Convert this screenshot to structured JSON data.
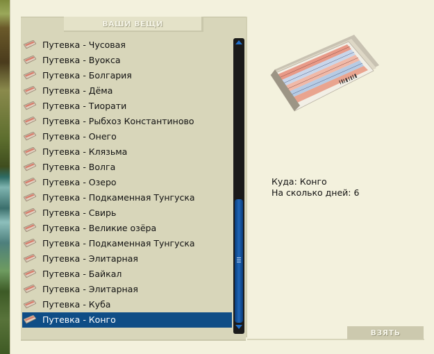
{
  "inventory": {
    "header": "ВАШИ ВЕЩИ",
    "items": [
      {
        "label": "Путевка - Чусовая",
        "icon": "ticket-icon"
      },
      {
        "label": "Путевка - Вуокса",
        "icon": "ticket-icon"
      },
      {
        "label": "Путевка - Болгария",
        "icon": "ticket-icon"
      },
      {
        "label": "Путевка - Дёма",
        "icon": "ticket-icon"
      },
      {
        "label": "Путевка - Тиорати",
        "icon": "ticket-icon"
      },
      {
        "label": "Путевка - Рыбхоз Константиново",
        "icon": "ticket-icon"
      },
      {
        "label": "Путевка - Онего",
        "icon": "ticket-icon"
      },
      {
        "label": "Путевка - Клязьма",
        "icon": "ticket-icon"
      },
      {
        "label": "Путевка - Волга",
        "icon": "ticket-icon"
      },
      {
        "label": "Путевка - Озеро",
        "icon": "ticket-icon"
      },
      {
        "label": "Путевка - Подкаменная Тунгуска",
        "icon": "ticket-icon"
      },
      {
        "label": "Путевка - Свирь",
        "icon": "ticket-icon"
      },
      {
        "label": "Путевка - Великие озёра",
        "icon": "ticket-icon"
      },
      {
        "label": "Путевка - Подкаменная Тунгуска",
        "icon": "ticket-icon"
      },
      {
        "label": "Путевка - Элитарная",
        "icon": "ticket-icon"
      },
      {
        "label": "Путевка - Байкал",
        "icon": "ticket-icon"
      },
      {
        "label": "Путевка - Элитарная",
        "icon": "ticket-icon"
      },
      {
        "label": "Путевка - Куба",
        "icon": "ticket-icon"
      },
      {
        "label": "Путевка - Конго",
        "icon": "ticket-icon",
        "selected": true
      }
    ],
    "selected_index": 18,
    "colors": {
      "selection": "#0f4d86",
      "scroll_thumb": "#1f66b8",
      "panel": "#d8d6ba"
    }
  },
  "details": {
    "destination_label": "Куда:",
    "destination_value": "Конго",
    "days_label": "На сколько дней:",
    "days_value": "6",
    "preview_icon": "ticket-booklet-image"
  },
  "actions": {
    "take_label": "ВЗЯТЬ"
  }
}
